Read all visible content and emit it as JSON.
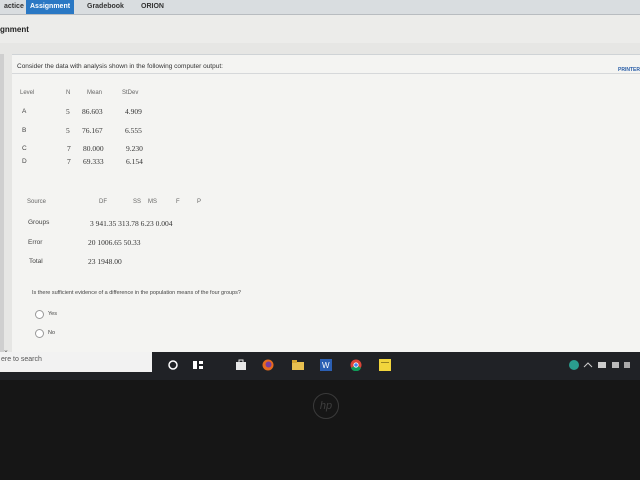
{
  "nav": {
    "tabs": [
      "actice",
      "Assignment",
      "Gradebook",
      "ORION"
    ],
    "active_index": 1
  },
  "page": {
    "title": "gnment",
    "printer_label": "PRINTER"
  },
  "question": {
    "intro": "Consider the data with analysis shown in the following computer output:",
    "summary_table": {
      "headers": [
        "Level",
        "N",
        "Mean",
        "StDev"
      ],
      "rows": [
        [
          "A",
          "5",
          "86.603",
          "4.909"
        ],
        [
          "B",
          "5",
          "76.167",
          "6.555"
        ],
        [
          "C",
          "7",
          "80.000",
          "9.230"
        ],
        [
          "D",
          "7",
          "69.333",
          "6.154"
        ]
      ]
    },
    "anova_table": {
      "headers": [
        "Source",
        "DF",
        "SS",
        "MS",
        "F",
        "P"
      ],
      "rows": [
        {
          "label": "Groups",
          "values": "3  941.35  313.78  6.23  0.004"
        },
        {
          "label": "Error",
          "values": "20  1006.65  50.33"
        },
        {
          "label": "Total",
          "values": "23  1948.00"
        }
      ]
    },
    "prompt": "Is there sufficient evidence of a difference in the population means of the four groups?",
    "options": [
      "Yes",
      "No"
    ]
  },
  "taskbar": {
    "search_placeholder": "ere to search",
    "icons": [
      "cortana-icon",
      "task-view-icon",
      "store-icon",
      "firefox-icon",
      "file-explorer-icon",
      "word-icon",
      "chrome-icon",
      "sticky-notes-icon",
      "system-tray-icons"
    ]
  },
  "hardware": {
    "logo": "hp"
  }
}
